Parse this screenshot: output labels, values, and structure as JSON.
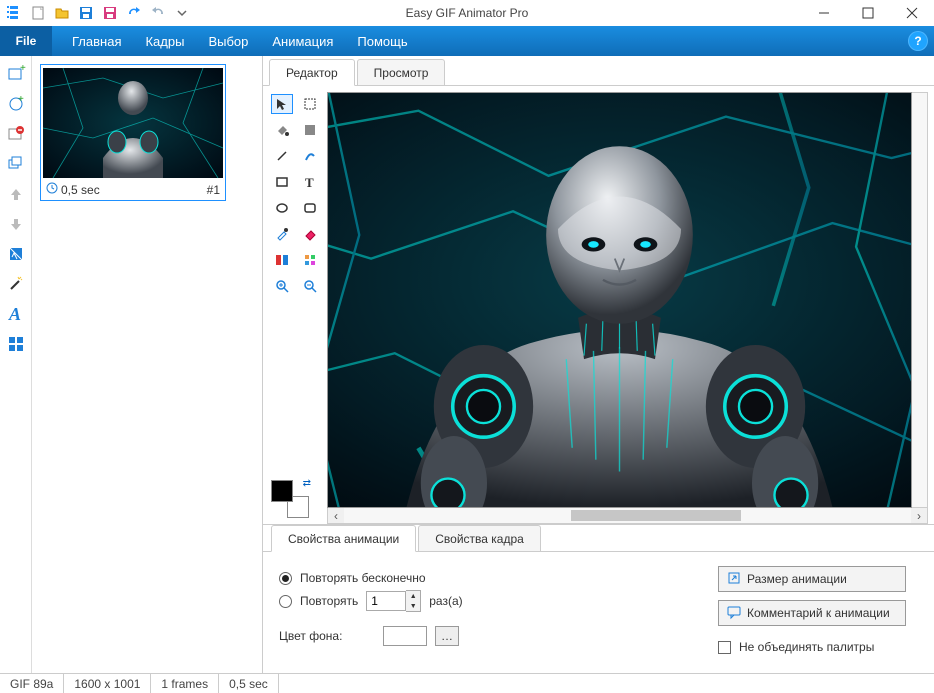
{
  "window": {
    "title": "Easy GIF Animator Pro"
  },
  "ribbon": {
    "file_label": "File",
    "items": [
      "Главная",
      "Кадры",
      "Выбор",
      "Анимация",
      "Помощь"
    ]
  },
  "editor_tabs": {
    "editor": "Редактор",
    "preview": "Просмотр"
  },
  "left_tools": [
    "add-frame",
    "insert-frame",
    "delete-frame",
    "duplicate-frame",
    "move-up",
    "move-down",
    "effects",
    "wizard",
    "text",
    "grid"
  ],
  "frames": [
    {
      "duration": "0,5 sec",
      "index": "#1"
    }
  ],
  "draw_tools": [
    [
      "pointer",
      "lasso-rect"
    ],
    [
      "fill",
      "rect-fill"
    ],
    [
      "line",
      "brush"
    ],
    [
      "rect",
      "text"
    ],
    [
      "ellipse",
      "rounded-rect"
    ],
    [
      "eyedropper",
      "eraser"
    ],
    [
      "crop",
      "palette"
    ],
    [
      "zoom-in",
      "zoom-out"
    ]
  ],
  "properties": {
    "tabs": {
      "anim": "Свойства анимации",
      "frame": "Свойства кадра"
    },
    "repeat_forever": "Повторять бесконечно",
    "repeat": "Повторять",
    "repeat_n": "1",
    "repeat_times": "раз(а)",
    "bg_color": "Цвет фона:",
    "size_btn": "Размер анимации",
    "comment_btn": "Комментарий к анимации",
    "no_merge_palettes": "Не объединять палитры"
  },
  "status": {
    "format": "GIF 89a",
    "dims": "1600 x 1001",
    "frames": "1 frames",
    "total": "0,5 sec"
  }
}
